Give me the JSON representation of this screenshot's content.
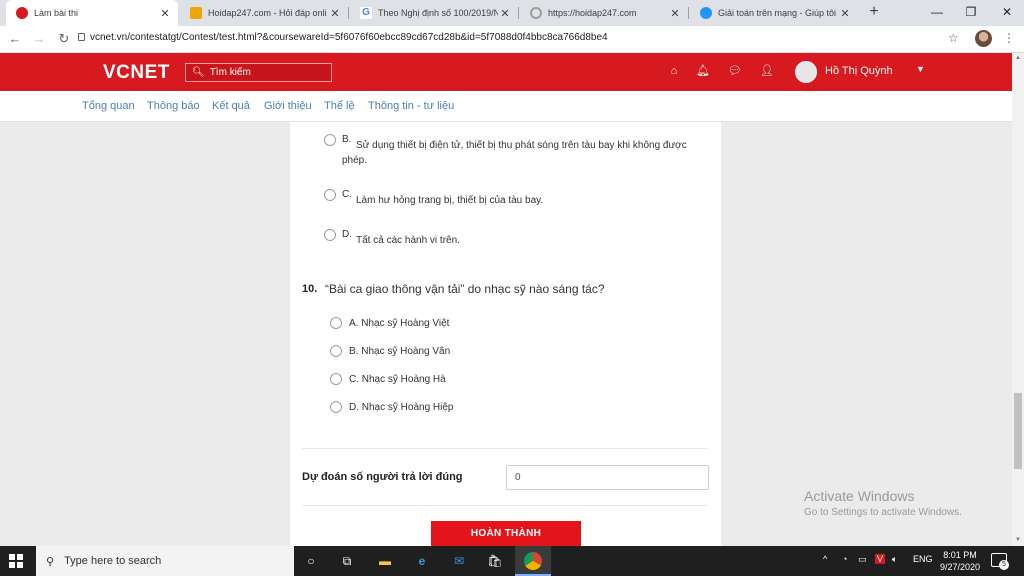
{
  "browser": {
    "tabs": [
      {
        "title": "Làm bài thi",
        "favicon_color": "#d71920"
      },
      {
        "title": "Hoidap247.com - Hỏi đáp onli",
        "favicon_color": "#f0a500"
      },
      {
        "title": "Theo Nghị định số 100/2019/N",
        "favicon_color": "#4285f4"
      },
      {
        "title": "https://hoidap247.com",
        "favicon_color": "#9e9e9e"
      },
      {
        "title": "Giải toán trên mạng - Giúp tôi",
        "favicon_color": "#2196f3"
      }
    ],
    "url": "vcnet.vn/contestatgt/Contest/test.html?&coursewareId=5f6076f60ebcc89cd67cd28b&id=5f7088d0f4bbc8ca766d8be4"
  },
  "header": {
    "logo": "VCNET",
    "search_placeholder": "Tìm kiếm",
    "user_name": "Hồ Thị Quỳnh",
    "brand_color": "#d71920"
  },
  "subnav": [
    "Tổng quan",
    "Thông báo",
    "Kết quả",
    "Giới thiệu",
    "Thể lệ",
    "Thông tin - tư liệu"
  ],
  "prev_options": [
    {
      "letter": "B.",
      "text": "Sử dụng thiết bị điện tử, thiết bị thu phát sóng trên tàu bay khi không được phép."
    },
    {
      "letter": "C.",
      "text": "Làm hư hỏng trang bị, thiết bị của tàu bay."
    },
    {
      "letter": "D.",
      "text": "Tất cả các hành vi trên."
    }
  ],
  "question": {
    "number": "10.",
    "text": "“Bài ca giao thông vận tải” do nhạc sỹ nào sáng tác?",
    "answers": [
      {
        "label": "A. Nhạc sỹ Hoàng Việt"
      },
      {
        "label": "B. Nhạc sỹ Hoàng Vân"
      },
      {
        "label": "C. Nhạc sỹ Hoàng Hà"
      },
      {
        "label": "D. Nhạc sỹ Hoàng Hiệp"
      }
    ]
  },
  "predict": {
    "label": "Dự đoán số người trả lời đúng",
    "value": "0"
  },
  "finish_label": "HOÀN THÀNH",
  "watermark": {
    "title": "Activate Windows",
    "subtitle": "Go to Settings to activate Windows."
  },
  "taskbar": {
    "search_placeholder": "Type here to search",
    "lang": "ENG",
    "time": "8:01 PM",
    "date": "9/27/2020",
    "notification_count": "5"
  }
}
